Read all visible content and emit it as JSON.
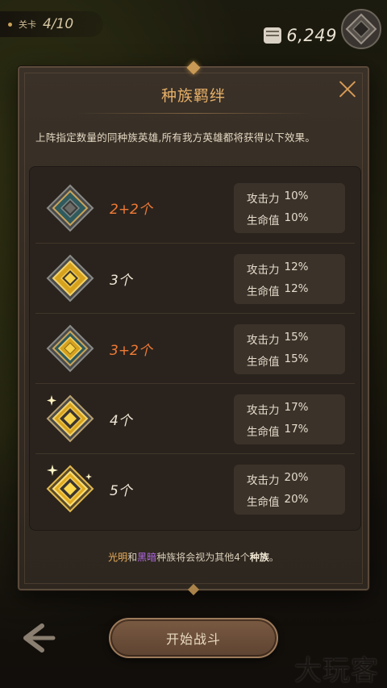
{
  "top_bar": {
    "level_label": "关卡",
    "level_value": "4/10",
    "power_value": "6,249",
    "power_icon": "fist-icon",
    "rank_icon": "rank-badge-icon"
  },
  "modal": {
    "title": "种族羁绊",
    "description": "上阵指定数量的同种族英雄,所有我方英雄都将获得以下效果。",
    "tiers": [
      {
        "count": "2+2个",
        "count_color": "orange",
        "emblem": "teal-diamond-emblem-icon",
        "attack_label": "攻击力",
        "attack_value": "10%",
        "hp_label": "生命值",
        "hp_value": "10%"
      },
      {
        "count": "3个",
        "count_color": "white",
        "emblem": "gold-diamond-emblem-icon",
        "attack_label": "攻击力",
        "attack_value": "12%",
        "hp_label": "生命值",
        "hp_value": "12%"
      },
      {
        "count": "3+2个",
        "count_color": "orange",
        "emblem": "teal-gold-diamond-emblem-icon",
        "attack_label": "攻击力",
        "attack_value": "15%",
        "hp_label": "生命值",
        "hp_value": "15%"
      },
      {
        "count": "4个",
        "count_color": "white",
        "emblem": "gold-diamond-sparkle-emblem-icon",
        "attack_label": "攻击力",
        "attack_value": "17%",
        "hp_label": "生命值",
        "hp_value": "17%"
      },
      {
        "count": "5个",
        "count_color": "white",
        "emblem": "gold-diamond-radiant-emblem-icon",
        "attack_label": "攻击力",
        "attack_value": "20%",
        "hp_label": "生命值",
        "hp_value": "20%"
      }
    ],
    "footnote": {
      "light": "光明",
      "and": "和",
      "dark": "黑暗",
      "middle": "种族将会视为其他4个",
      "race": "种族",
      "end": "。"
    }
  },
  "bottom": {
    "start_label": "开始战斗",
    "back_icon": "back-arrow-icon",
    "watermark": "大玩客"
  },
  "colors": {
    "title": "#e7b068",
    "orange_count": "#f07a35",
    "light_race": "#efb05a",
    "dark_race": "#b069e0"
  }
}
